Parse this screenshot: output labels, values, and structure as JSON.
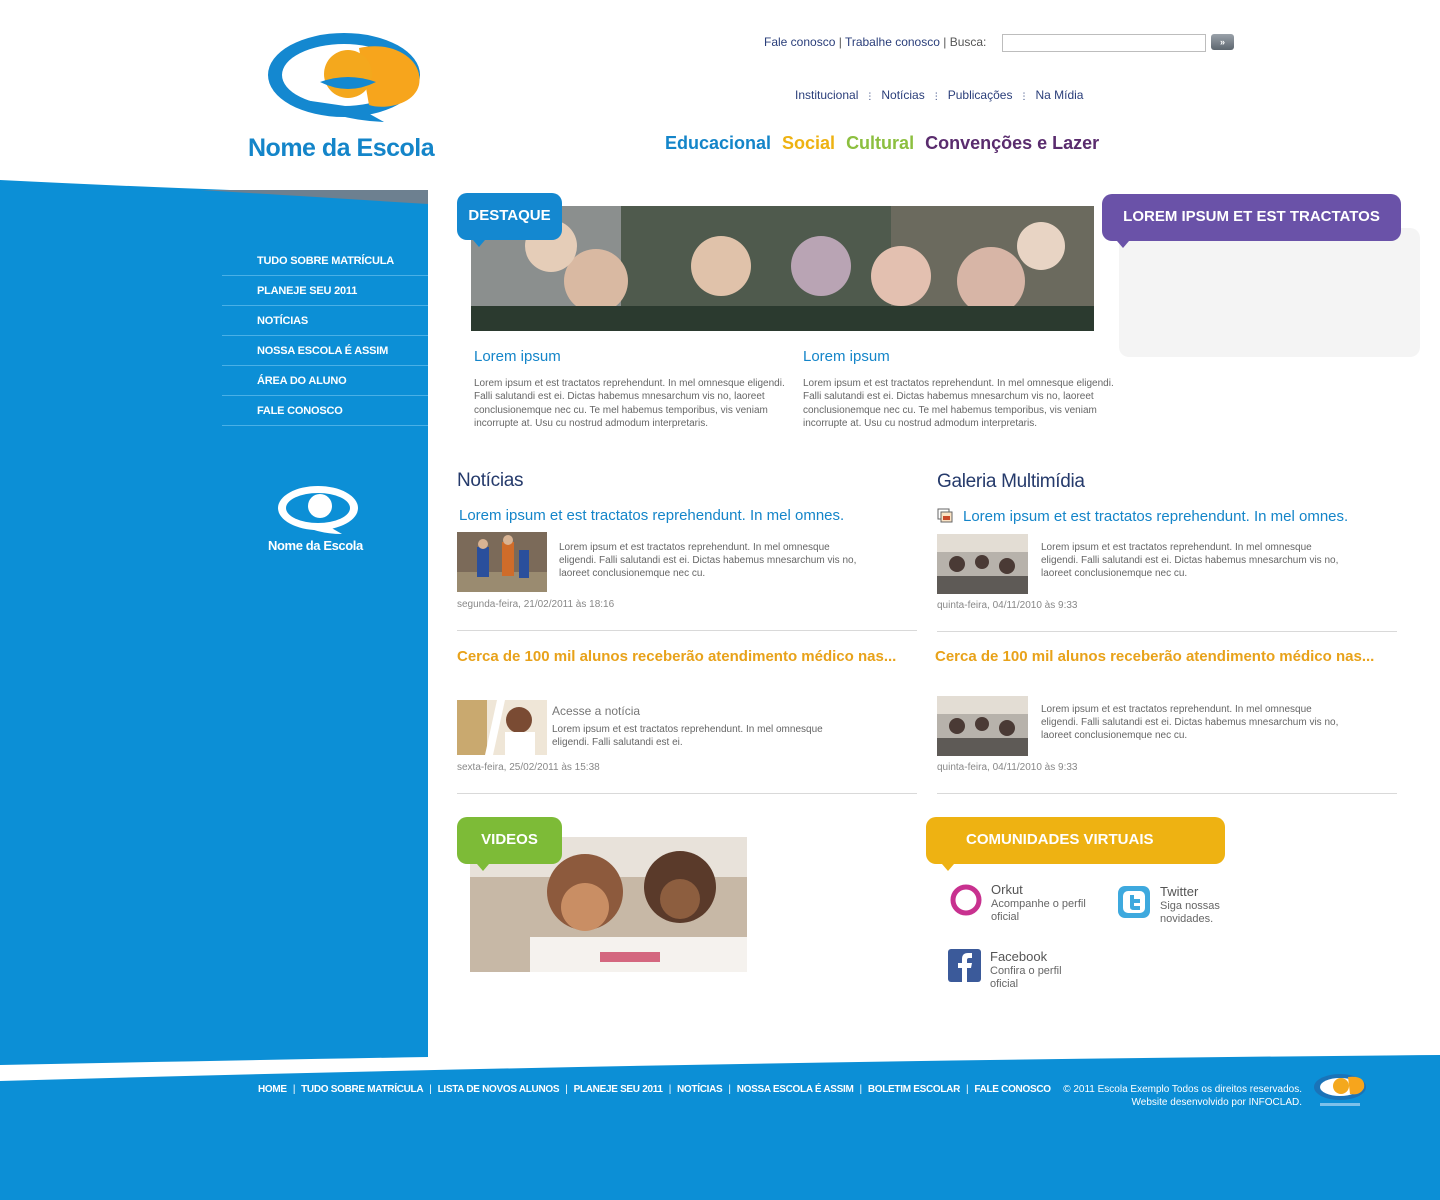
{
  "header": {
    "logo_name": "Nome da Escola",
    "top_links": [
      "Fale conosco",
      "Trabalhe conosco"
    ],
    "search_label": "Busca:",
    "search_value": "",
    "search_button": "»",
    "inst_nav": [
      "Institucional",
      "Notícias",
      "Publicações",
      "Na Mídia"
    ],
    "categories": [
      {
        "label": "Educacional",
        "color": "#1485c9"
      },
      {
        "label": "Social",
        "color": "#eeb212"
      },
      {
        "label": "Cultural",
        "color": "#8cbf3f"
      },
      {
        "label": "Convenções e Lazer",
        "color": "#5a2c6e"
      }
    ]
  },
  "sidebar": {
    "items": [
      "TUDO SOBRE MATRÍCULA",
      "PLANEJE SEU 2011",
      "NOTÍCIAS",
      "NOSSA ESCOLA É ASSIM",
      "ÁREA DO ALUNO",
      "FALE CONOSCO"
    ],
    "logo_name": "Nome da Escola"
  },
  "destaque": {
    "tab": "DESTAQUE",
    "items": [
      {
        "title": "Lorem ipsum",
        "text": "Lorem ipsum et est tractatos reprehendunt. In mel omnesque eligendi. Falli salutandi est ei. Dictas habemus mnesarchum vis no, laoreet conclusionemque nec cu. Te mel habemus temporibus, vis veniam incorrupte at. Usu cu nostrud admodum interpretaris."
      },
      {
        "title": "Lorem ipsum",
        "text": "Lorem ipsum et est tractatos reprehendunt. In mel omnesque eligendi. Falli salutandi est ei. Dictas habemus mnesarchum vis no, laoreet conclusionemque nec cu. Te mel habemus temporibus, vis veniam incorrupte at. Usu cu nostrud admodum interpretaris."
      }
    ]
  },
  "side_box": {
    "tab": "LOREM IPSUM ET EST TRACTATOS"
  },
  "noticias": {
    "heading": "Notícias",
    "item1": {
      "title": "Lorem ipsum et est tractatos reprehendunt. In mel omnes.",
      "text": "Lorem ipsum et est tractatos reprehendunt. In mel omnesque eligendi. Falli salutandi est ei. Dictas habemus mnesarchum vis no, laoreet conclusionemque nec cu.",
      "date": "segunda-feira, 21/02/2011 às 18:16"
    },
    "item2": {
      "title": "Cerca de 100 mil alunos receberão atendimento médico nas...",
      "access": "Acesse a notícia",
      "text": "Lorem ipsum et est tractatos reprehendunt. In mel omnesque eligendi. Falli salutandi est ei.",
      "date": "sexta-feira, 25/02/2011 às 15:38"
    }
  },
  "galeria": {
    "heading": "Galeria Multimídia",
    "item1": {
      "title": "Lorem ipsum et est tractatos reprehendunt. In mel omnes.",
      "text": "Lorem ipsum et est tractatos reprehendunt. In mel omnesque eligendi. Falli salutandi est ei. Dictas habemus mnesarchum vis no, laoreet conclusionemque nec cu.",
      "date": "quinta-feira, 04/11/2010 às 9:33"
    },
    "item2": {
      "title": "Cerca de 100 mil alunos receberão atendimento médico nas...",
      "text": "Lorem ipsum et est tractatos reprehendunt. In mel omnesque eligendi. Falli salutandi est ei. Dictas habemus mnesarchum vis no, laoreet conclusionemque nec cu.",
      "date": "quinta-feira, 04/11/2010 às 9:33"
    }
  },
  "videos": {
    "tab": "VIDEOS"
  },
  "comunidades": {
    "tab": "COMUNIDADES VIRTUAIS",
    "orkut": {
      "name": "Orkut",
      "sub": "Acompanhe o perfil oficial"
    },
    "twitter": {
      "name": "Twitter",
      "sub": "Siga nossas novidades."
    },
    "facebook": {
      "name": "Facebook",
      "sub": "Confira o perfil oficial"
    }
  },
  "footer": {
    "nav": [
      "HOME",
      "TUDO SOBRE MATRÍCULA",
      "LISTA DE NOVOS ALUNOS",
      "PLANEJE SEU 2011",
      "NOTÍCIAS",
      "NOSSA ESCOLA É ASSIM",
      "BOLETIM ESCOLAR",
      "FALE CONOSCO"
    ],
    "copyright_line1": "© 2011 Escola Exemplo Todos os direitos reservados.",
    "copyright_line2": "Website desenvolvido por INFOCLAD."
  }
}
